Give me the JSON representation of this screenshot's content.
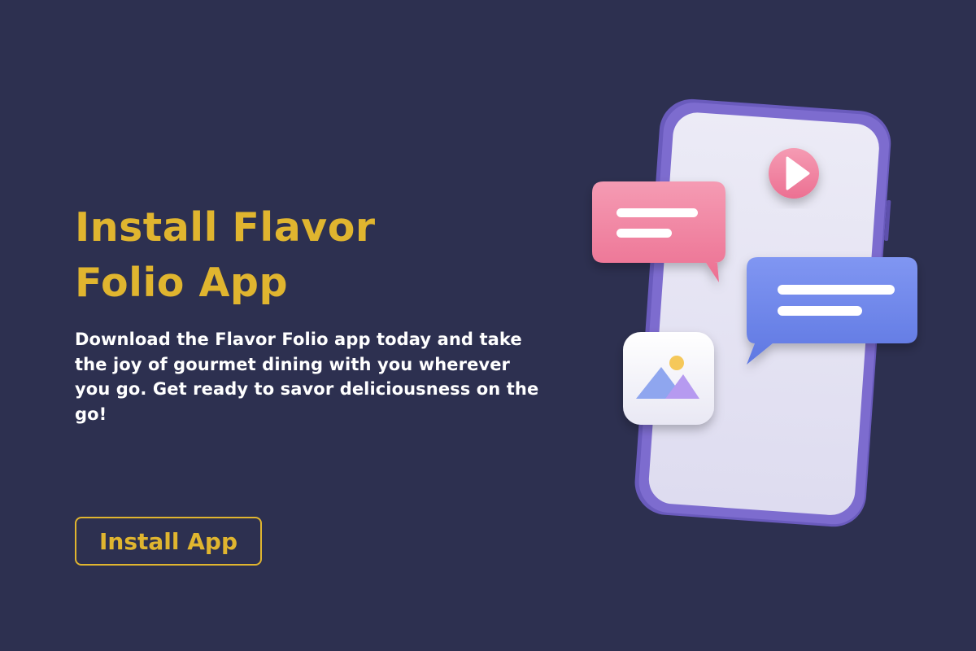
{
  "hero": {
    "title_line_1": "Install Flavor",
    "title_line_2": "Folio App",
    "description": "Download the Flavor Folio app today and take the joy of gourmet dining with you wherever you go. Get ready to savor deliciousness on the go!",
    "install_button_label": "Install App"
  },
  "illustration": {
    "icons": [
      "smartphone-icon",
      "play-icon",
      "chat-bubble-icon",
      "image-icon"
    ]
  },
  "colors": {
    "background": "#2d3050",
    "accent": "#e0b52f",
    "text": "#ffffff",
    "phone_frame": "#7d6ccf",
    "phone_screen": "#e4e3f2",
    "pink": "#f07f9f",
    "blue": "#6b84ea"
  }
}
